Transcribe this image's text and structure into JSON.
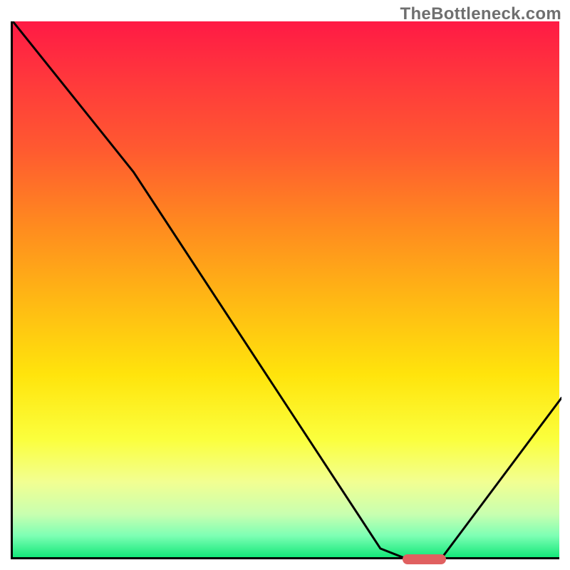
{
  "watermark": "TheBottleneck.com",
  "chart_data": {
    "type": "line",
    "title": "",
    "xlabel": "",
    "ylabel": "",
    "xlim": [
      0,
      100
    ],
    "ylim": [
      0,
      100
    ],
    "x": [
      0,
      22,
      67,
      72,
      78,
      100
    ],
    "y": [
      100,
      72,
      2,
      0,
      0,
      30
    ],
    "background_gradient": [
      {
        "stop": 0.0,
        "color": "#ff1a45"
      },
      {
        "stop": 0.5,
        "color": "#ffc400"
      },
      {
        "stop": 0.8,
        "color": "#fff75a"
      },
      {
        "stop": 1.0,
        "color": "#14e87a"
      }
    ],
    "marker": {
      "x_start": 71,
      "x_end": 79,
      "y": 0,
      "color": "#e06060"
    }
  }
}
